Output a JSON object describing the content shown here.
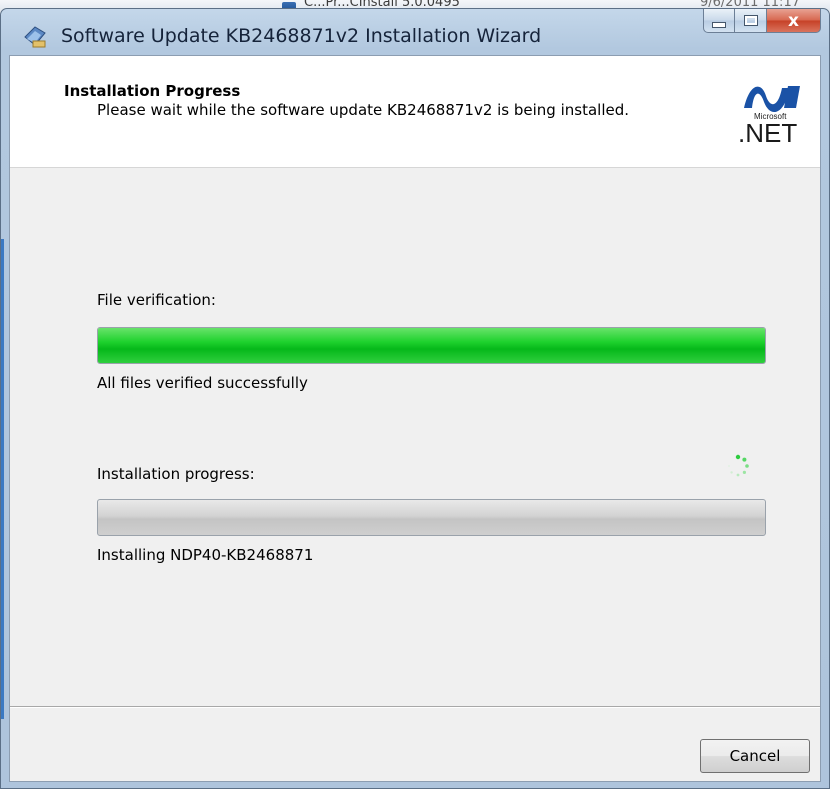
{
  "background_window": {
    "item_name": "C...Pr...CInstall 5.0.0495",
    "item_date": "9/6/2011 11:17"
  },
  "window": {
    "title": "Software Update KB2468871v2 Installation Wizard",
    "close_glyph": "x"
  },
  "header": {
    "title": "Installation Progress",
    "subtitle": "Please wait while the software update KB2468871v2 is being installed.",
    "logo_small": "Microsoft",
    "logo_text": ".NET"
  },
  "file_verification": {
    "label": "File verification:",
    "progress": 1.0,
    "status": "All files verified successfully"
  },
  "installation": {
    "label": "Installation progress:",
    "progress": 0.0,
    "status": "Installing NDP40-KB2468871"
  },
  "footer": {
    "cancel_label": "Cancel"
  },
  "colors": {
    "progress_green": "#1ed12d",
    "logo_blue": "#1a52a6"
  },
  "icons": {
    "app": "installer-app-icon",
    "spinner": "busy-spinner-icon"
  }
}
